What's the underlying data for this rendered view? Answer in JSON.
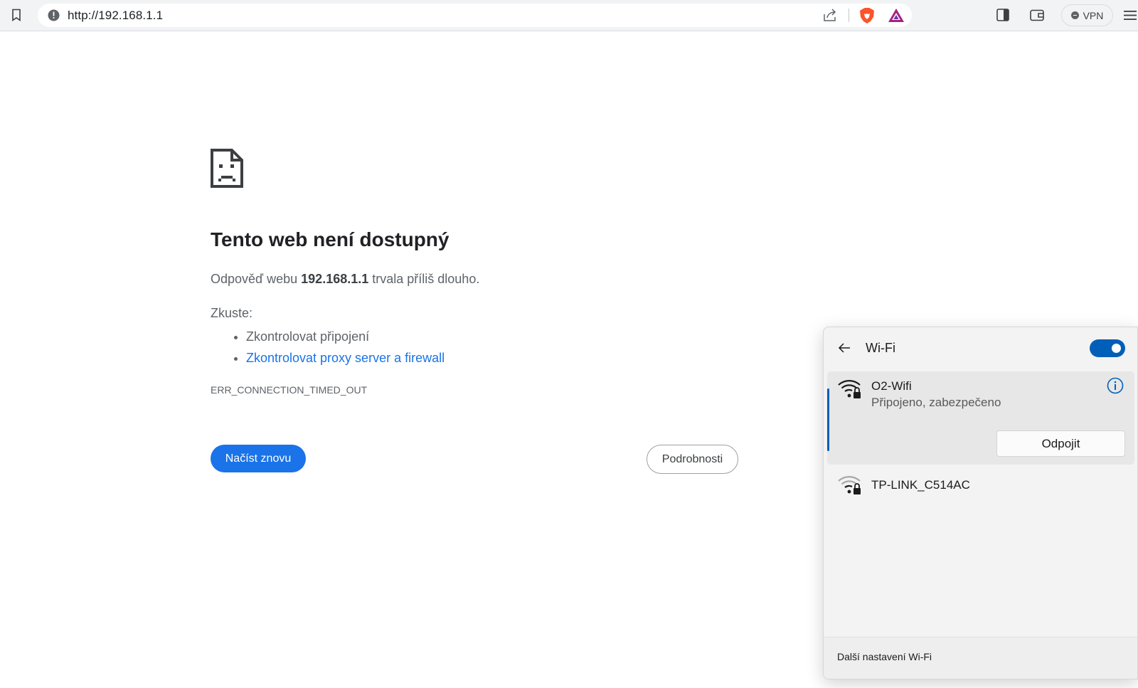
{
  "browser": {
    "url": "http://192.168.1.1",
    "vpn_label": "VPN",
    "icons": [
      "bookmark-icon",
      "site-info-icon",
      "share-icon",
      "brave-shields-icon",
      "brave-rewards-icon",
      "sidebar-icon",
      "wallet-icon",
      "menu-icon"
    ]
  },
  "error_page": {
    "title": "Tento web není dostupný",
    "desc_prefix": "Odpověď webu ",
    "desc_host": "192.168.1.1",
    "desc_suffix": " trvala příliš dlouho.",
    "try_label": "Zkuste:",
    "suggestions": [
      "Zkontrolovat připojení",
      "Zkontrolovat proxy server a firewall"
    ],
    "error_code": "ERR_CONNECTION_TIMED_OUT",
    "reload_button": "Načíst znovu",
    "details_button": "Podrobnosti"
  },
  "wifi_panel": {
    "title": "Wi-Fi",
    "toggle_on": true,
    "accent_color": "#005fb8",
    "networks": [
      {
        "name": "O2-Wifi",
        "status": "Připojeno, zabezpečeno",
        "action": "Odpojit"
      },
      {
        "name": "TP-LINK_C514AC"
      }
    ],
    "footer_link": "Další nastavení Wi-Fi"
  }
}
